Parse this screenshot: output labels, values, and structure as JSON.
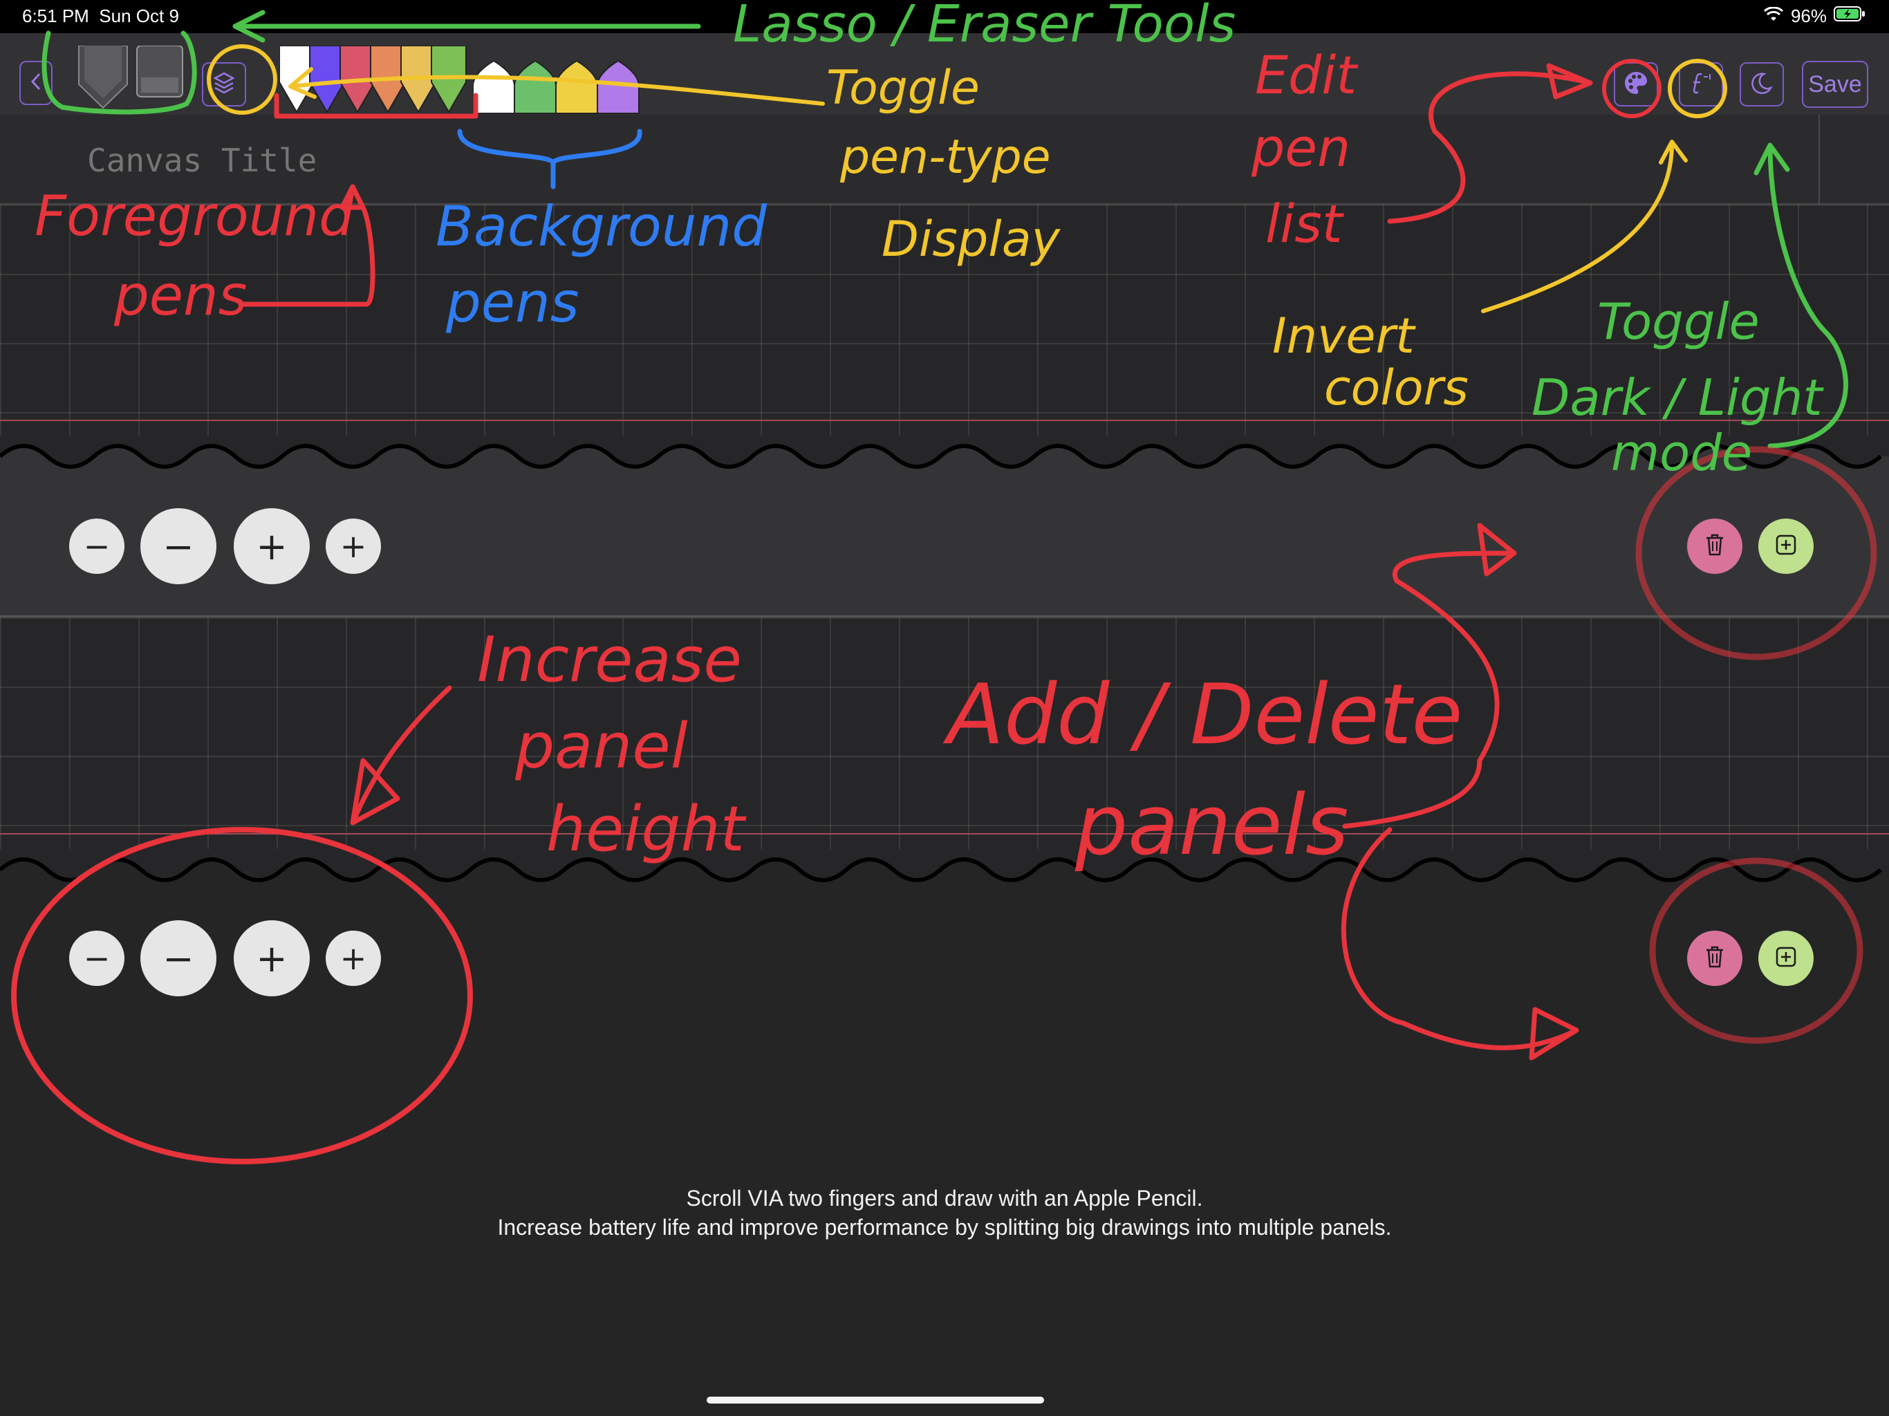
{
  "status_bar": {
    "time": "6:51 PM",
    "date": "Sun Oct 9",
    "battery": "96%"
  },
  "toolbar": {
    "save_label": "Save",
    "foreground_pens": [
      "#ffffff",
      "#6a4cf0",
      "#d9566a",
      "#e58a5a",
      "#e8c15a",
      "#7bbf55"
    ],
    "background_pens": [
      "#ffffff",
      "#6cc06a",
      "#f0d043",
      "#b07ae8"
    ]
  },
  "canvas": {
    "title_placeholder": "Canvas Title"
  },
  "panels": [
    {
      "decrease_small": "−",
      "decrease_large": "−",
      "increase_large": "+",
      "increase_small": "+"
    },
    {
      "decrease_small": "−",
      "decrease_large": "−",
      "increase_large": "+",
      "increase_small": "+"
    }
  ],
  "footer": {
    "line1": "Scroll VIA two fingers and draw with an Apple Pencil.",
    "line2": "Increase battery life and improve performance by splitting big drawings into multiple panels."
  },
  "annotations": {
    "lasso_eraser": "Lasso / Eraser Tools",
    "toggle_pen_type": [
      "Toggle",
      "pen-type",
      "Display"
    ],
    "foreground_pens": [
      "Foreground",
      "pens"
    ],
    "background_pens": [
      "Background",
      "pens"
    ],
    "edit_pen_list": [
      "Edit",
      "pen",
      "list"
    ],
    "invert_colors": [
      "Invert",
      "colors"
    ],
    "toggle_dark_light": [
      "Toggle",
      "Dark / Light",
      "mode"
    ],
    "increase_panel_height": [
      "Increase",
      "panel",
      "height"
    ],
    "add_delete_panels": [
      "Add / Delete",
      "panels"
    ]
  },
  "colors": {
    "accent": "#8b67dd",
    "delete": "#d9739a",
    "add": "#bfe08d",
    "annot_red": "#e8343c",
    "annot_green": "#4cc24a",
    "annot_yellow": "#f2c62c",
    "annot_blue": "#2f7cf2"
  }
}
